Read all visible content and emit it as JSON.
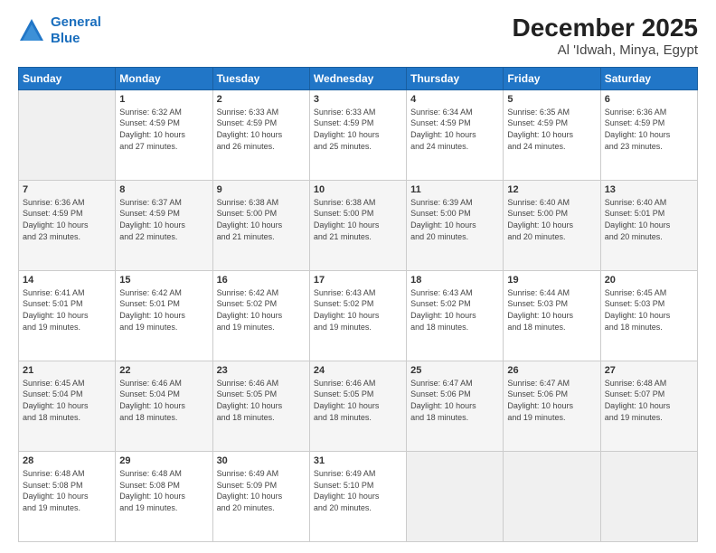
{
  "header": {
    "logo_line1": "General",
    "logo_line2": "Blue",
    "title": "December 2025",
    "subtitle": "Al 'Idwah, Minya, Egypt"
  },
  "columns": [
    "Sunday",
    "Monday",
    "Tuesday",
    "Wednesday",
    "Thursday",
    "Friday",
    "Saturday"
  ],
  "weeks": [
    [
      {
        "day": "",
        "info": ""
      },
      {
        "day": "1",
        "info": "Sunrise: 6:32 AM\nSunset: 4:59 PM\nDaylight: 10 hours\nand 27 minutes."
      },
      {
        "day": "2",
        "info": "Sunrise: 6:33 AM\nSunset: 4:59 PM\nDaylight: 10 hours\nand 26 minutes."
      },
      {
        "day": "3",
        "info": "Sunrise: 6:33 AM\nSunset: 4:59 PM\nDaylight: 10 hours\nand 25 minutes."
      },
      {
        "day": "4",
        "info": "Sunrise: 6:34 AM\nSunset: 4:59 PM\nDaylight: 10 hours\nand 24 minutes."
      },
      {
        "day": "5",
        "info": "Sunrise: 6:35 AM\nSunset: 4:59 PM\nDaylight: 10 hours\nand 24 minutes."
      },
      {
        "day": "6",
        "info": "Sunrise: 6:36 AM\nSunset: 4:59 PM\nDaylight: 10 hours\nand 23 minutes."
      }
    ],
    [
      {
        "day": "7",
        "info": "Sunrise: 6:36 AM\nSunset: 4:59 PM\nDaylight: 10 hours\nand 23 minutes."
      },
      {
        "day": "8",
        "info": "Sunrise: 6:37 AM\nSunset: 4:59 PM\nDaylight: 10 hours\nand 22 minutes."
      },
      {
        "day": "9",
        "info": "Sunrise: 6:38 AM\nSunset: 5:00 PM\nDaylight: 10 hours\nand 21 minutes."
      },
      {
        "day": "10",
        "info": "Sunrise: 6:38 AM\nSunset: 5:00 PM\nDaylight: 10 hours\nand 21 minutes."
      },
      {
        "day": "11",
        "info": "Sunrise: 6:39 AM\nSunset: 5:00 PM\nDaylight: 10 hours\nand 20 minutes."
      },
      {
        "day": "12",
        "info": "Sunrise: 6:40 AM\nSunset: 5:00 PM\nDaylight: 10 hours\nand 20 minutes."
      },
      {
        "day": "13",
        "info": "Sunrise: 6:40 AM\nSunset: 5:01 PM\nDaylight: 10 hours\nand 20 minutes."
      }
    ],
    [
      {
        "day": "14",
        "info": "Sunrise: 6:41 AM\nSunset: 5:01 PM\nDaylight: 10 hours\nand 19 minutes."
      },
      {
        "day": "15",
        "info": "Sunrise: 6:42 AM\nSunset: 5:01 PM\nDaylight: 10 hours\nand 19 minutes."
      },
      {
        "day": "16",
        "info": "Sunrise: 6:42 AM\nSunset: 5:02 PM\nDaylight: 10 hours\nand 19 minutes."
      },
      {
        "day": "17",
        "info": "Sunrise: 6:43 AM\nSunset: 5:02 PM\nDaylight: 10 hours\nand 19 minutes."
      },
      {
        "day": "18",
        "info": "Sunrise: 6:43 AM\nSunset: 5:02 PM\nDaylight: 10 hours\nand 18 minutes."
      },
      {
        "day": "19",
        "info": "Sunrise: 6:44 AM\nSunset: 5:03 PM\nDaylight: 10 hours\nand 18 minutes."
      },
      {
        "day": "20",
        "info": "Sunrise: 6:45 AM\nSunset: 5:03 PM\nDaylight: 10 hours\nand 18 minutes."
      }
    ],
    [
      {
        "day": "21",
        "info": "Sunrise: 6:45 AM\nSunset: 5:04 PM\nDaylight: 10 hours\nand 18 minutes."
      },
      {
        "day": "22",
        "info": "Sunrise: 6:46 AM\nSunset: 5:04 PM\nDaylight: 10 hours\nand 18 minutes."
      },
      {
        "day": "23",
        "info": "Sunrise: 6:46 AM\nSunset: 5:05 PM\nDaylight: 10 hours\nand 18 minutes."
      },
      {
        "day": "24",
        "info": "Sunrise: 6:46 AM\nSunset: 5:05 PM\nDaylight: 10 hours\nand 18 minutes."
      },
      {
        "day": "25",
        "info": "Sunrise: 6:47 AM\nSunset: 5:06 PM\nDaylight: 10 hours\nand 18 minutes."
      },
      {
        "day": "26",
        "info": "Sunrise: 6:47 AM\nSunset: 5:06 PM\nDaylight: 10 hours\nand 19 minutes."
      },
      {
        "day": "27",
        "info": "Sunrise: 6:48 AM\nSunset: 5:07 PM\nDaylight: 10 hours\nand 19 minutes."
      }
    ],
    [
      {
        "day": "28",
        "info": "Sunrise: 6:48 AM\nSunset: 5:08 PM\nDaylight: 10 hours\nand 19 minutes."
      },
      {
        "day": "29",
        "info": "Sunrise: 6:48 AM\nSunset: 5:08 PM\nDaylight: 10 hours\nand 19 minutes."
      },
      {
        "day": "30",
        "info": "Sunrise: 6:49 AM\nSunset: 5:09 PM\nDaylight: 10 hours\nand 20 minutes."
      },
      {
        "day": "31",
        "info": "Sunrise: 6:49 AM\nSunset: 5:10 PM\nDaylight: 10 hours\nand 20 minutes."
      },
      {
        "day": "",
        "info": ""
      },
      {
        "day": "",
        "info": ""
      },
      {
        "day": "",
        "info": ""
      }
    ]
  ]
}
